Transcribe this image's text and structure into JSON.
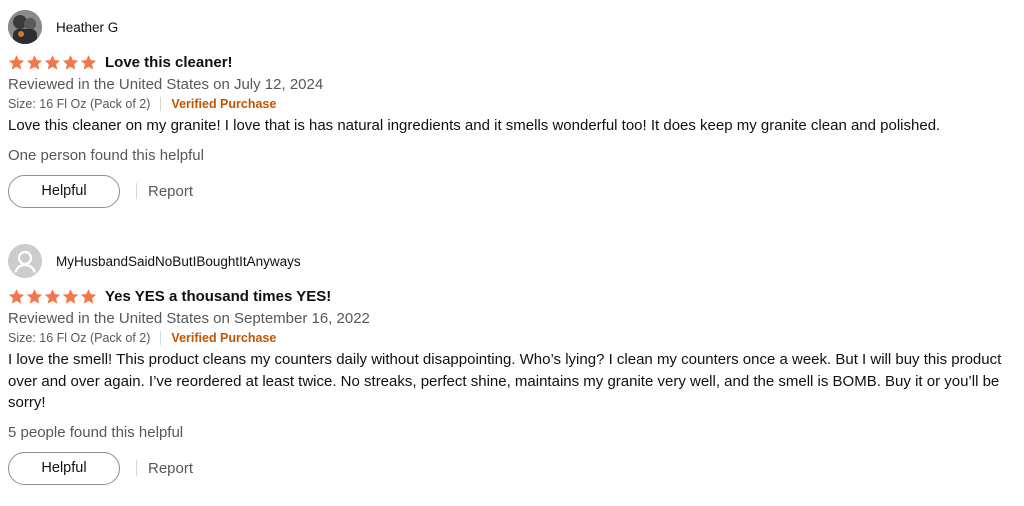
{
  "colors": {
    "star": "#f3774a",
    "verified": "#c45500",
    "muted": "#565959"
  },
  "reviews": [
    {
      "avatar": "profile-photo",
      "name": "Heather G",
      "rating": 5,
      "title": "Love this cleaner!",
      "date": "Reviewed in the United States on July 12, 2024",
      "size": "Size: 16 Fl Oz (Pack of 2)",
      "verified": "Verified Purchase",
      "body": "Love this cleaner on my granite! I love that is has natural ingredients and it smells wonderful too! It does keep my granite clean and polished.",
      "helpful_count": "One person found this helpful",
      "helpful_label": "Helpful",
      "report_label": "Report"
    },
    {
      "avatar": "default-avatar-icon",
      "name": "MyHusbandSaidNoButIBoughtItAnyways",
      "rating": 5,
      "title": "Yes YES a thousand times YES!",
      "date": "Reviewed in the United States on September 16, 2022",
      "size": "Size: 16 Fl Oz (Pack of 2)",
      "verified": "Verified Purchase",
      "body": "I love the smell! This product cleans my counters daily without disappointing. Who’s lying? I clean my counters once a week. But I will buy this product over and over again. I’ve reordered at least twice. No streaks, perfect shine, maintains my granite very well, and the smell is BOMB. Buy it or you’ll be sorry!",
      "helpful_count": "5 people found this helpful",
      "helpful_label": "Helpful",
      "report_label": "Report"
    }
  ]
}
